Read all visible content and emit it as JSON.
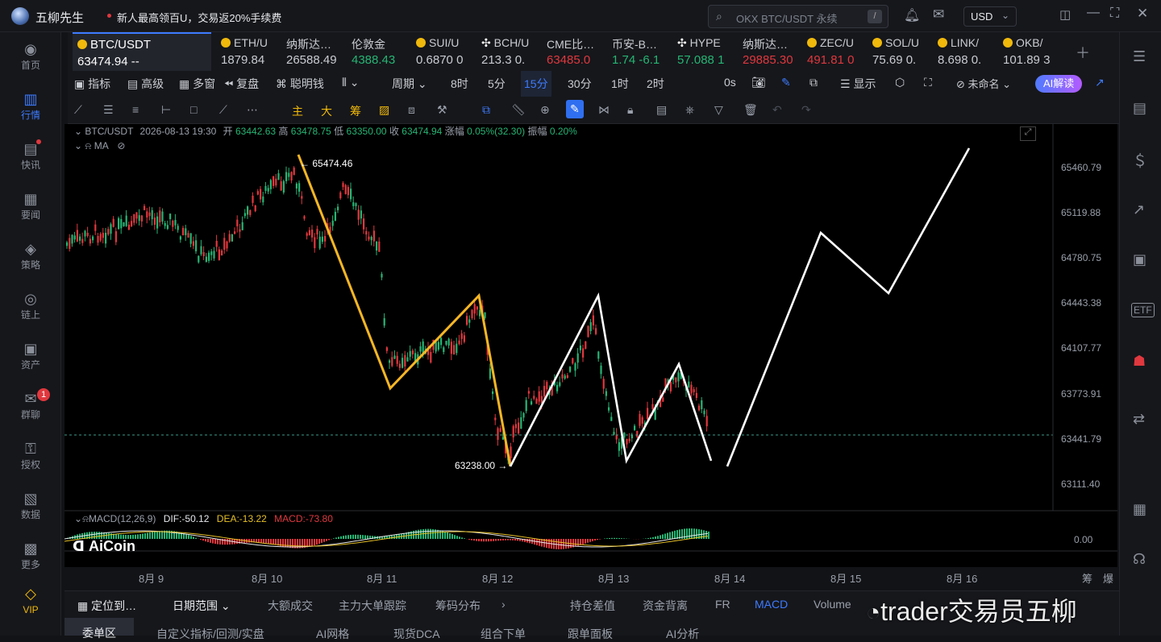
{
  "app": {
    "name": "五柳先生",
    "notice": "新人最高领百U，交易返20%手续费",
    "search_placeholder": "OKX BTC/USDT 永续",
    "search_shortcut": "/",
    "currency": "USD"
  },
  "sidebar": {
    "items": [
      {
        "label": "首页",
        "icon": "home-icon",
        "glyph": "◉"
      },
      {
        "label": "行情",
        "icon": "market-icon",
        "glyph": "▥",
        "active": true
      },
      {
        "label": "快讯",
        "icon": "news-icon",
        "glyph": "▤"
      },
      {
        "label": "要闻",
        "icon": "headline-icon",
        "glyph": "▦"
      },
      {
        "label": "策略",
        "icon": "strategy-icon",
        "glyph": "◈"
      },
      {
        "label": "链上",
        "icon": "chain-icon",
        "glyph": "◎"
      },
      {
        "label": "资产",
        "icon": "wallet-icon",
        "glyph": "▣"
      },
      {
        "label": "群聊",
        "icon": "chat-icon",
        "glyph": "✉",
        "badge": "1"
      },
      {
        "label": "授权",
        "icon": "key-icon",
        "glyph": "⚿"
      },
      {
        "label": "数据",
        "icon": "data-icon",
        "glyph": "▧"
      },
      {
        "label": "更多",
        "icon": "more-icon",
        "glyph": "▩"
      },
      {
        "label": "VIP",
        "icon": "vip-icon",
        "glyph": "◇"
      }
    ]
  },
  "tickers": [
    {
      "name": "BTC/USDT",
      "price": "63474.94",
      "change": "--",
      "color": "#ffffff"
    },
    {
      "name": "ETH/U",
      "price": "1879.84",
      "color": "#c9ccd2"
    },
    {
      "name": "纳斯达…",
      "price": "26588.49",
      "color": "#c9ccd2"
    },
    {
      "name": "伦敦金",
      "price": "4388.43",
      "color": "#26b574"
    },
    {
      "name": "SUI/U",
      "price": "0.6870",
      "change": "0",
      "color": "#c9ccd2"
    },
    {
      "name": "BCH/U",
      "price": "213.3",
      "change": "0.",
      "color": "#c9ccd2"
    },
    {
      "name": "CME比…",
      "price": "63485.0",
      "color": "#e0383e"
    },
    {
      "name": "币安-B…",
      "price": "1.74",
      "change": "-6.1",
      "color": "#26b574"
    },
    {
      "name": "HYPE",
      "price": "57.088",
      "change": "1",
      "color": "#26b574"
    },
    {
      "name": "纳斯达…",
      "price": "29885.30",
      "color": "#e0383e"
    },
    {
      "name": "ZEC/U",
      "price": "491.81",
      "change": "0",
      "color": "#e0383e"
    },
    {
      "name": "SOL/U",
      "price": "75.69",
      "change": "0.",
      "color": "#c9ccd2"
    },
    {
      "name": "LINK/",
      "price": "8.698",
      "change": "0.",
      "color": "#c9ccd2"
    },
    {
      "name": "OKB/",
      "price": "101.89",
      "change": "3",
      "color": "#c9ccd2"
    }
  ],
  "toolbar": {
    "indicators": "指标",
    "advanced": "高级",
    "multi": "多窗",
    "replay": "复盘",
    "smart": "聪明钱",
    "period_label": "周期",
    "periods": [
      "8时",
      "5分",
      "15分",
      "30分",
      "1时",
      "2时"
    ],
    "active_period": "15分",
    "seconds": "0s",
    "display": "显示",
    "layout_name": "未命名",
    "ai_read": "AI解读"
  },
  "drawbar": {
    "main": "主",
    "big": "大",
    "chips": "筹"
  },
  "chart": {
    "symbol": "BTC/USDT",
    "datetime": "2026-08-13 19:30",
    "open_label": "开",
    "open": "63442.63",
    "high_label": "高",
    "high": "63478.75",
    "low_label": "低",
    "low": "63350.00",
    "close_label": "收",
    "close": "63474.94",
    "change_label": "涨幅",
    "change": "0.05%(32.30)",
    "amp_label": "振幅",
    "amplitude": "0.20%",
    "ma_label": "MA",
    "price_ticks": [
      "65460.79",
      "65119.88",
      "64780.75",
      "64443.38",
      "64107.77",
      "63773.91",
      "63441.79",
      "63111.40"
    ],
    "time_ticks": [
      "8月 9",
      "8月 10",
      "8月 11",
      "8月 12",
      "8月 13",
      "8月 14",
      "8月 15",
      "8月 16"
    ],
    "high_annotation": "65474.46",
    "low_annotation": "63238.00",
    "macd_header": "MACD(12,26,9)",
    "dif": "DIF:-50.12",
    "dea": "DEA:-13.22",
    "macd": "MACD:-73.80",
    "macd_zero": "0.00",
    "watermark": "AiCoin",
    "corner_a": "筹",
    "corner_b": "爆"
  },
  "bottombar": {
    "locate": "定位到…",
    "range": "日期范围",
    "tabs": [
      "大额成交",
      "主力大单跟踪",
      "筹码分布"
    ],
    "right_tabs": [
      "持仓差值",
      "资金背离",
      "FR",
      "MACD",
      "Volume"
    ],
    "active_right": "MACD"
  },
  "bottom2": {
    "tabs": [
      "委单区",
      "自定义指标/回测/实盘",
      "AI网格",
      "现货DCA",
      "组合下单",
      "跟单面板",
      "AI分析"
    ]
  },
  "overlay_watermark": "trader交易员五柳"
}
